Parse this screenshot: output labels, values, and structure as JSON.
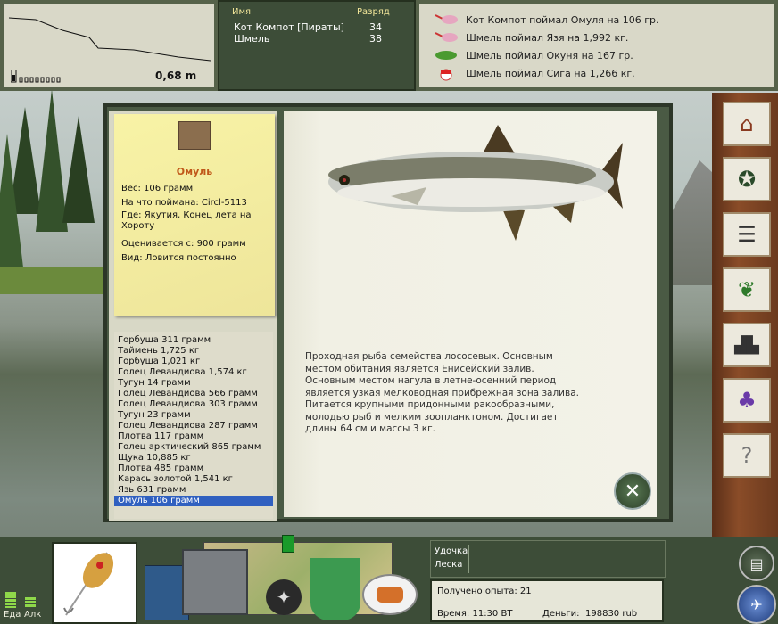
{
  "depth": {
    "value": "0,68 m"
  },
  "players": {
    "col_name": "Имя",
    "col_rank": "Разряд",
    "rows": [
      {
        "name": "Кот Компот [Пираты]",
        "rank": "34"
      },
      {
        "name": "Шмель",
        "rank": "38"
      }
    ]
  },
  "news": [
    "Кот Компот поймал Омуля на 106 гр.",
    "Шмель поймал Язя на 1,992 кг.",
    "Шмель поймал Окуня на 167 гр.",
    "Шмель поймал Сига на 1,266 кг."
  ],
  "fish_card": {
    "name": "Омуль",
    "weight": "Вес: 106 грамм",
    "caught_on": "На что поймана: Circl-5113",
    "where": "Где: Якутия, Конец лета на Хороту",
    "valued": "Оценивается с: 900 грамм",
    "kind": "Вид: Ловится постоянно"
  },
  "fish_list": [
    "Горбуша 311 грамм",
    "Таймень 1,725 кг",
    "Горбуша 1,021 кг",
    "Голец Левандиова 1,574 кг",
    "Тугун 14 грамм",
    "Голец Левандиова 566 грамм",
    "Голец Левандиова 303 грамм",
    "Тугун 23 грамм",
    "Голец Левандиова 287 грамм",
    "Плотва 117 грамм",
    "Голец арктический 865 грамм",
    "Щука 10,885 кг",
    "Плотва 485 грамм",
    "Карась золотой 1,541 кг",
    "Язь 631 грамм",
    "Омуль 106 грамм"
  ],
  "fish_list_selected": 15,
  "description": "Проходная рыба семейства лососевых. Основным местом обитания является Енисейский залив. Основным местом нагула в летне-осенний период является узкая мелководная прибрежная зона залива. Питается крупными придонными ракообразными, молодью рыб и мелким зоопланктоном. Достигает длины 64 см и массы 3 кг.",
  "bottom": {
    "food_label": "Еда",
    "alc_label": "Алк",
    "rod_label": "Удочка",
    "line_label": "Леска",
    "exp_label": "Получено опыта: 21",
    "time_label": "Время: 11:30 ВТ",
    "money_label": "Деньги:",
    "money_value": "198830 rub"
  },
  "icons": {
    "right_bar": [
      "house-icon",
      "compass-icon",
      "chat-icon",
      "laurel-icon",
      "podium-icon",
      "team-icon",
      "help-icon"
    ],
    "close": "close-icon"
  },
  "colors": {
    "selection": "#3060c0",
    "note": "#f4ee9e",
    "panel": "#3d4d38"
  }
}
